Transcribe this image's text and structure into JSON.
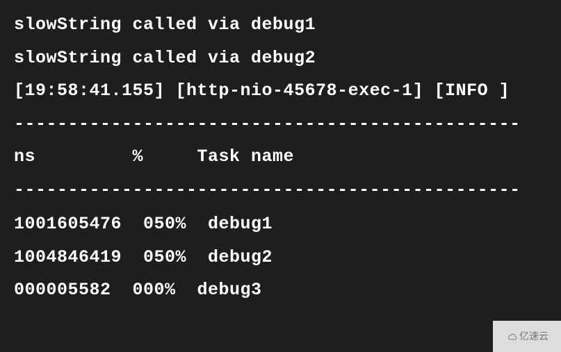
{
  "console": {
    "line1": "slowString called via debug1",
    "line2": "slowString called via debug2",
    "line3": "[19:58:41.155] [http-nio-45678-exec-1] [INFO ]",
    "divider": "-----------------------------------------------",
    "header": "ns         %     Task name",
    "row1": "1001605476  050%  debug1",
    "row2": "1004846419  050%  debug2",
    "row3": "000005582  000%  debug3"
  },
  "watermark": {
    "text": "亿速云"
  }
}
